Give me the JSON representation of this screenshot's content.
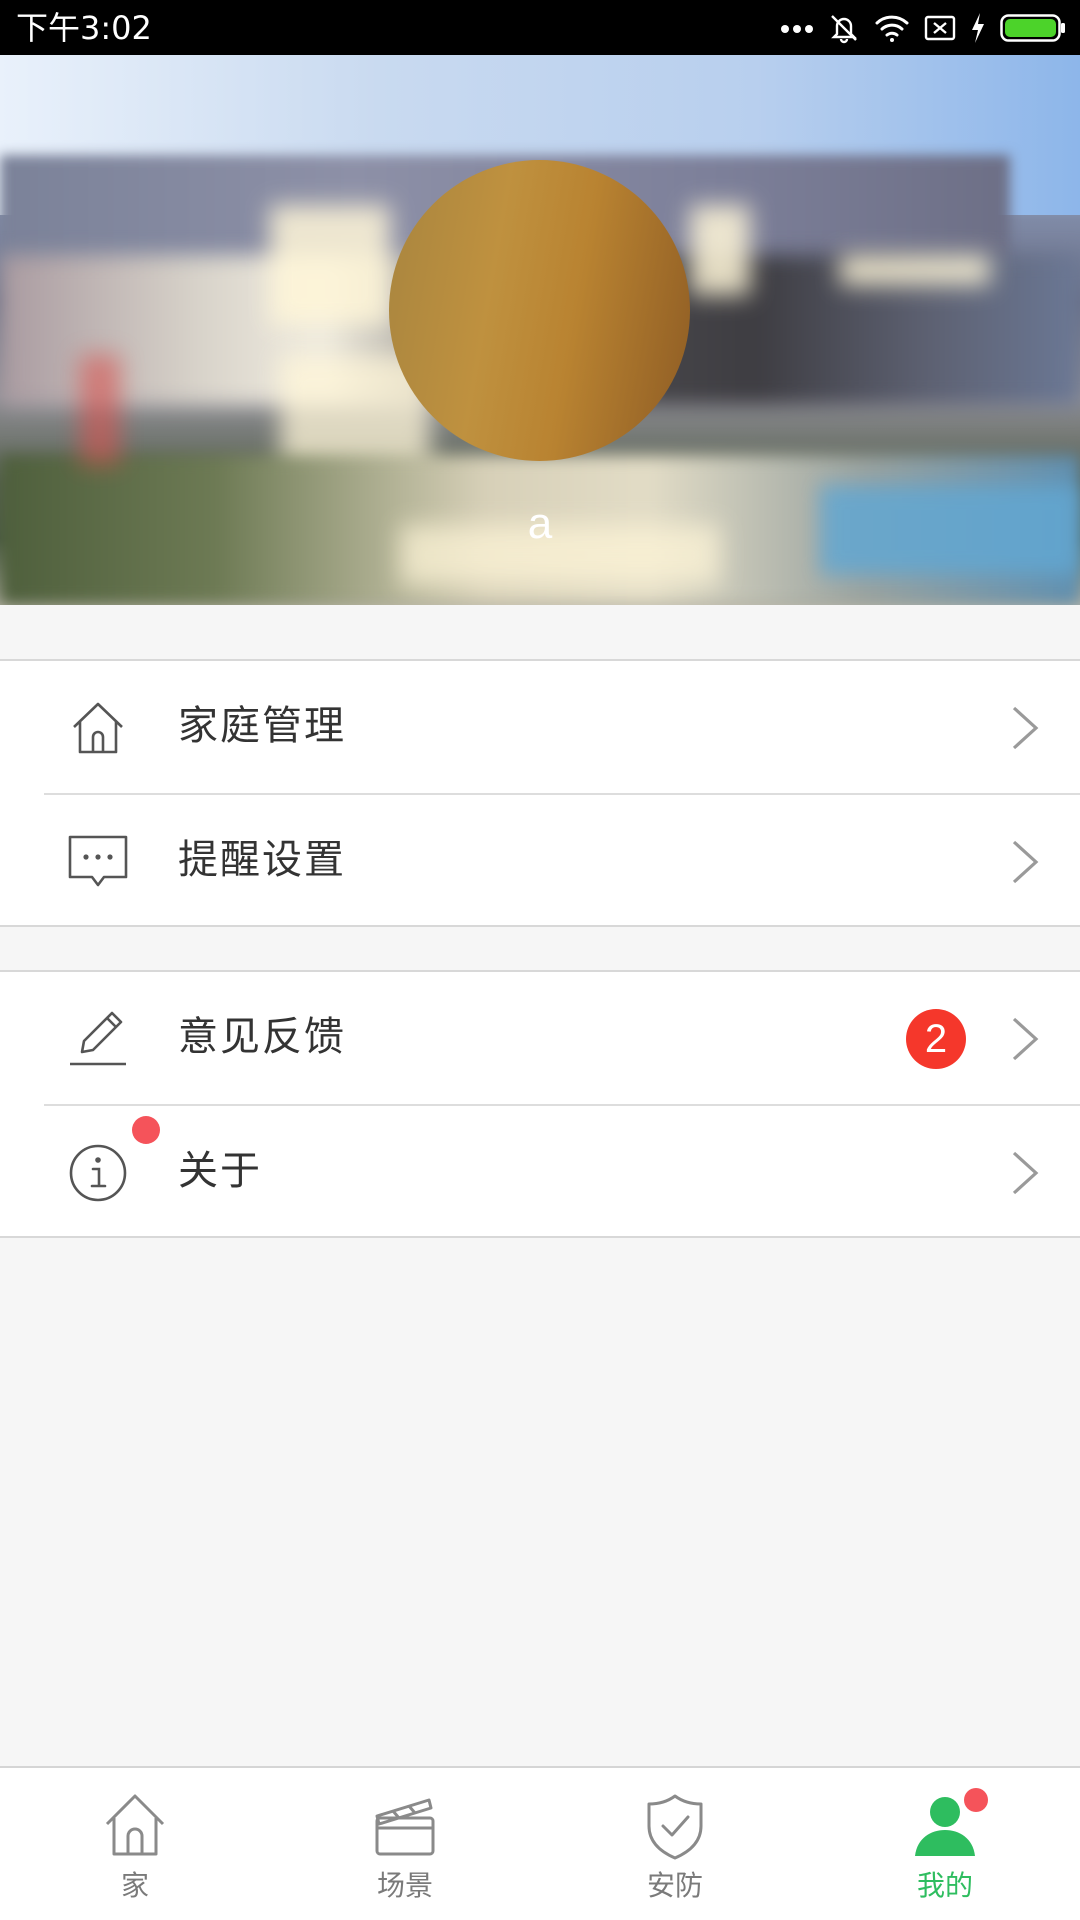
{
  "status_bar": {
    "time": "下午3:02",
    "icons": [
      "more-dots-icon",
      "mute-bell-icon",
      "wifi-icon",
      "sim-error-icon",
      "charging-icon",
      "battery-icon"
    ],
    "battery_color": "#4cd32a"
  },
  "profile": {
    "username": "a",
    "avatar_colors": [
      "#a8853f",
      "#8e5c24"
    ]
  },
  "menu": {
    "group1": [
      {
        "label": "家庭管理",
        "icon": "home-icon"
      },
      {
        "label": "提醒设置",
        "icon": "message-bubble-icon"
      }
    ],
    "group2": [
      {
        "label": "意见反馈",
        "icon": "pen-icon",
        "badge_count": "2"
      },
      {
        "label": "关于",
        "icon": "info-icon",
        "has_dot": true
      }
    ]
  },
  "tabbar": {
    "active_color": "#2ebd5f",
    "inactive_color": "#7a7a7a",
    "tabs": [
      {
        "label": "家",
        "icon": "home-icon",
        "active": false
      },
      {
        "label": "场景",
        "icon": "clapperboard-icon",
        "active": false
      },
      {
        "label": "安防",
        "icon": "shield-check-icon",
        "active": false
      },
      {
        "label": "我的",
        "icon": "user-icon",
        "active": true,
        "has_dot": true
      }
    ]
  },
  "colors": {
    "badge_red": "#f5372b",
    "dot_red": "#f5535a",
    "page_bg": "#f6f6f6"
  }
}
